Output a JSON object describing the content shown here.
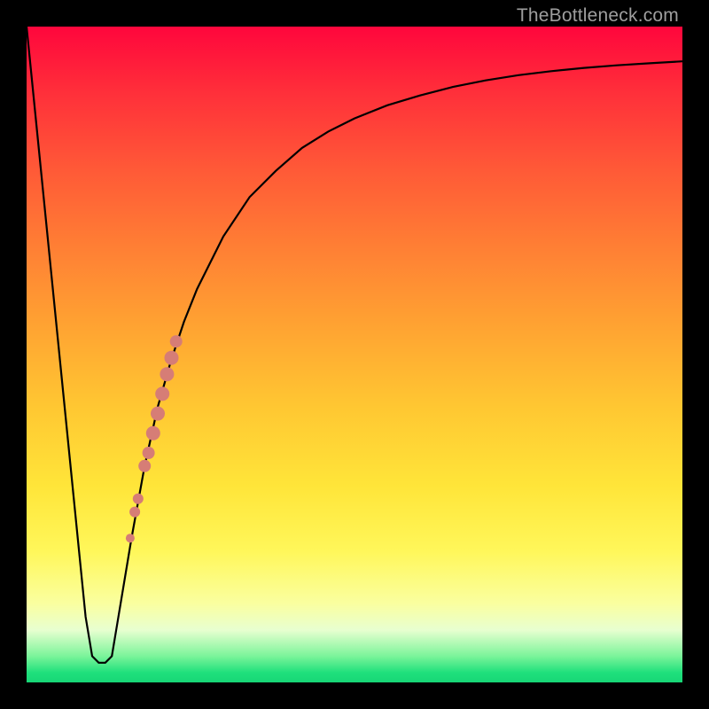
{
  "watermark": "TheBottleneck.com",
  "chart_data": {
    "type": "line",
    "title": "",
    "xlabel": "",
    "ylabel": "",
    "xlim": [
      0,
      100
    ],
    "ylim": [
      0,
      100
    ],
    "grid": false,
    "legend": false,
    "series": [
      {
        "name": "bottleneck-curve",
        "x": [
          0,
          2,
          4,
          6,
          8,
          9,
          10,
          11,
          12,
          13,
          14,
          16,
          18,
          20,
          22,
          24,
          26,
          28,
          30,
          34,
          38,
          42,
          46,
          50,
          55,
          60,
          65,
          70,
          75,
          80,
          85,
          90,
          95,
          100
        ],
        "y": [
          100,
          80,
          60,
          40,
          20,
          10,
          4,
          3,
          3,
          4,
          10,
          22,
          33,
          42,
          49,
          55,
          60,
          64,
          68,
          74,
          78,
          81.5,
          84,
          86,
          88,
          89.5,
          90.8,
          91.8,
          92.6,
          93.2,
          93.7,
          94.1,
          94.4,
          94.7
        ]
      }
    ],
    "markers": {
      "name": "highlighted-points",
      "color": "#d67d76",
      "points": [
        {
          "x": 18.0,
          "y": 33,
          "r": 7
        },
        {
          "x": 18.6,
          "y": 35,
          "r": 7
        },
        {
          "x": 19.3,
          "y": 38,
          "r": 8
        },
        {
          "x": 20.0,
          "y": 41,
          "r": 8
        },
        {
          "x": 20.7,
          "y": 44,
          "r": 8
        },
        {
          "x": 21.4,
          "y": 47,
          "r": 8
        },
        {
          "x": 22.1,
          "y": 49.5,
          "r": 8
        },
        {
          "x": 22.8,
          "y": 52,
          "r": 7
        },
        {
          "x": 16.5,
          "y": 26,
          "r": 6
        },
        {
          "x": 17.0,
          "y": 28,
          "r": 6
        },
        {
          "x": 15.8,
          "y": 22,
          "r": 5
        }
      ]
    },
    "background_gradient": {
      "direction": "vertical",
      "stops": [
        {
          "pos": 0.0,
          "color": "#ff063c"
        },
        {
          "pos": 0.5,
          "color": "#ffb733"
        },
        {
          "pos": 0.82,
          "color": "#fff75a"
        },
        {
          "pos": 1.0,
          "color": "#17d676"
        }
      ]
    }
  }
}
